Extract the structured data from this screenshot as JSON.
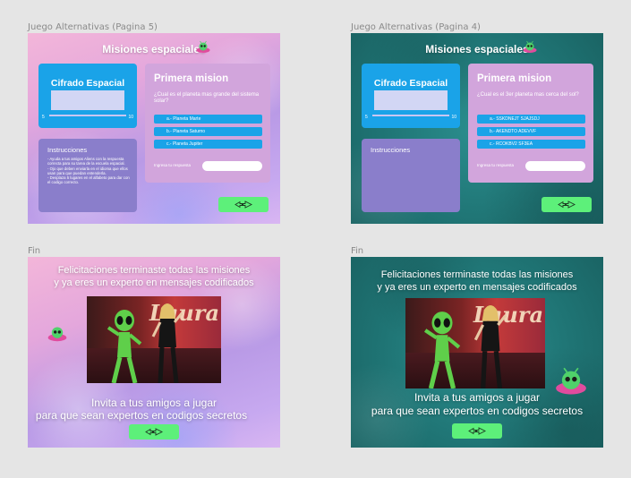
{
  "frames": {
    "mission5": {
      "label": "Juego Alternativas (Pagina 5)",
      "title": "Misiones espaciales",
      "cipher_title": "Cifrado Espacial",
      "slider_min": "5",
      "slider_max": "10",
      "instructions_title": "Instrucciones",
      "instructions": [
        "Ayuda a tus amigos Aliens con la respuesta correcta para su tarea de la escuela espacial.",
        "Ojo que deben enviarla en el idioma que ellos usan para que puedan entenderla.",
        "Desplaza 5 lugares en el alfabeto para dar con el codigo correcto."
      ],
      "mission_title": "Primera mision",
      "question": "¿Cual es el planeta mas grande del sistema solar?",
      "options": [
        "a.- Planeta Marte",
        "b.- Planeta Saturno",
        "c.- Planeta Jupiter"
      ],
      "answer_label": "Ingresa tu respuesta"
    },
    "mission4": {
      "label": "Juego Alternativas (Pagina 4)",
      "title": "Misiones espaciales",
      "cipher_title": "Cifrado Espacial",
      "slider_min": "5",
      "slider_max": "10",
      "instructions_title": "Instrucciones",
      "mission_title": "Primera mision",
      "question": "¿Cual es el 3er planeta mas cerca del sol?",
      "options": [
        "a.- SSKDNEJT SJAJSDJ",
        "b.- AKENDTO ADEVVF",
        "c.- RCOKBV2 SF3EA"
      ],
      "answer_label": "Ingresa tu respuesta"
    },
    "fin_left": {
      "label": "Fin",
      "congrats_line1": "Felicitaciones terminaste todas las misiones",
      "congrats_line2": "y ya eres un experto en mensajes codificados",
      "invite_line1": "Invita a tus amigos a jugar",
      "invite_line2": "para que sean expertos en codigos secretos",
      "video_logo": "Laura"
    },
    "fin_right": {
      "label": "Fin",
      "congrats_line1": "Felicitaciones terminaste todas las misiones",
      "congrats_line2": "y ya eres un experto en mensajes codificados",
      "invite_line1": "Invita a tus amigos a jugar",
      "invite_line2": "para que sean expertos en codigos secretos",
      "video_logo": "Laura"
    }
  },
  "icons": {
    "next_button": "rocket-arrow-icon",
    "alien": "alien-ufo-icon"
  },
  "colors": {
    "accent_blue": "#1aa3e8",
    "next_green": "#5df07a",
    "instructions_purple": "#8a7ecb",
    "mission_lilac": "#d2a5dc",
    "teal_bg": "#1f7474"
  }
}
